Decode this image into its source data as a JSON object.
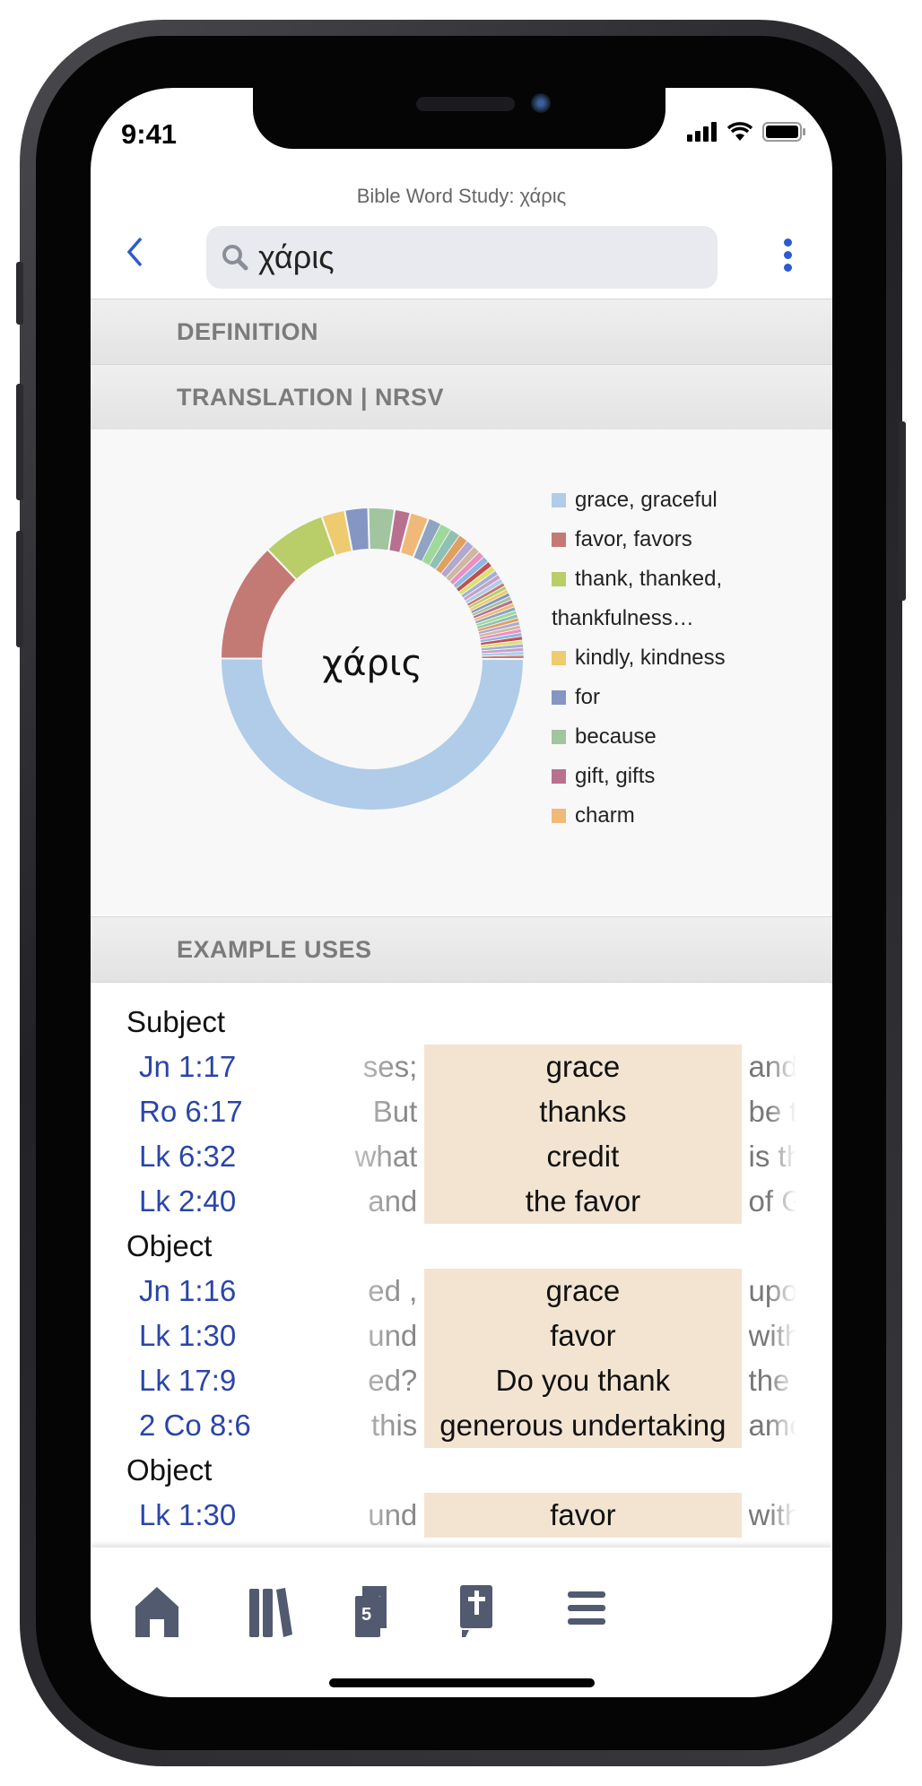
{
  "status_bar": {
    "time": "9:41"
  },
  "header": {
    "title": "Bible Word Study: χάρις",
    "search_value": "χάρις"
  },
  "sections": [
    {
      "label": "DEFINITION",
      "expanded": false
    },
    {
      "label": "TRANSLATION | NRSV",
      "expanded": true
    },
    {
      "label": "EXAMPLE USES",
      "expanded": true
    }
  ],
  "chart_data": {
    "type": "pie",
    "center_label": "χάρις",
    "legend_position": "right",
    "labels": [
      "grace, graceful",
      "favor, favors",
      "thank, thanked, thankfulness…",
      "kindly, kindness",
      "for",
      "because",
      "gift, gifts",
      "charm"
    ],
    "values": [
      50,
      12.8,
      6.7,
      2.5,
      2.5,
      2.8,
      1.7,
      2.0,
      1.4,
      1.2,
      1.1,
      1.0,
      0.9,
      0.8,
      0.7,
      0.7,
      0.6,
      0.6,
      0.5,
      0.5,
      0.5,
      0.4,
      0.4,
      0.4,
      0.4,
      0.4,
      0.4,
      0.4,
      0.4,
      0.4,
      0.4,
      0.4,
      0.4,
      0.4,
      0.4,
      0.4,
      0.4,
      0.4,
      0.4,
      0.4,
      0.4,
      0.4
    ],
    "colors": [
      "#b0cce8",
      "#c47a74",
      "#b9cd68",
      "#eecb6e",
      "#8596c4",
      "#a2c49e",
      "#b9708f",
      "#f0b97a",
      "#8fa4c0",
      "#9ed99a",
      "#8fc0b4",
      "#e0a060",
      "#b0a8d0",
      "#d0b8a0",
      "#e890c0",
      "#90b8e0",
      "#c05050",
      "#e0e070",
      "#a0b0d8",
      "#c8a0c8"
    ]
  },
  "examples": [
    {
      "group": "Subject"
    },
    {
      "ref": "Jn 1:17",
      "left": "ses;",
      "hit": "grace",
      "right": "and"
    },
    {
      "ref": "Ro 6:17",
      "left": "But",
      "hit": "thanks",
      "right": "be t"
    },
    {
      "ref": "Lk 6:32",
      "left": "what",
      "hit": "credit",
      "right": "is th"
    },
    {
      "ref": "Lk 2:40",
      "left": "and",
      "hit": "the favor",
      "right": "of G"
    },
    {
      "group": "Object"
    },
    {
      "ref": "Jn 1:16",
      "left": "ed ,",
      "hit": "grace",
      "right": "upo"
    },
    {
      "ref": "Lk 1:30",
      "left": "und",
      "hit": "favor",
      "right": "with"
    },
    {
      "ref": "Lk 17:9",
      "left": "ed?",
      "hit": "Do you thank",
      "right": "the"
    },
    {
      "ref": "2 Co 8:6",
      "left": "this",
      "hit": "generous undertaking",
      "right": "amo"
    },
    {
      "group": "Object"
    },
    {
      "ref": "Lk 1:30",
      "left": "und",
      "hit": "favor",
      "right": "with"
    }
  ],
  "tabbar": {
    "items": [
      "home-icon",
      "library-icon",
      "open-resources-icon",
      "bible-icon",
      "menu-icon"
    ],
    "open_count": "5"
  },
  "accent_color": "#2a5bd0",
  "highlight_color": "#f3e4d2"
}
